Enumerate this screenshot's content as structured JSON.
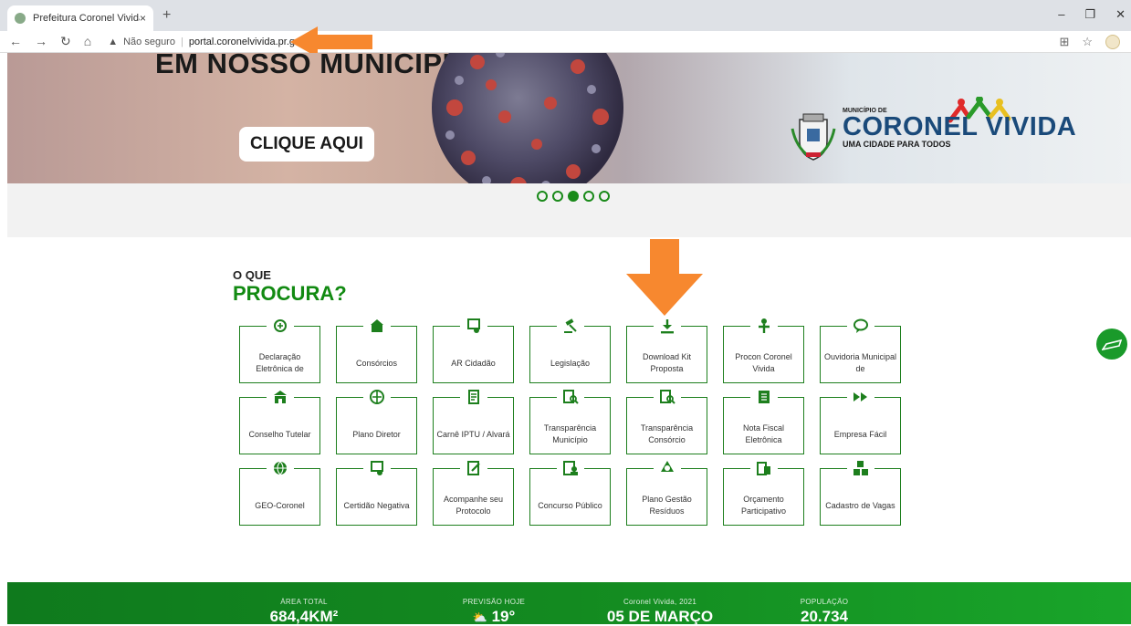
{
  "browser": {
    "tab_title": "Prefeitura Coronel Vivida",
    "tab_close": "×",
    "new_tab": "+",
    "security_label": "Não seguro",
    "url": "portal.coronelvivida.pr.gov.br/#"
  },
  "hero": {
    "headline": "EM NOSSO MUNICÍPIO",
    "cta": "CLIQUE AQUI",
    "brand_small": "MUNICÍPIO DE",
    "brand_name": "CORONEL VIVIDA",
    "brand_slogan": "UMA CIDADE PARA TODOS",
    "slides": 5,
    "active_slide": 3
  },
  "section": {
    "title_small": "O QUE",
    "title_big": "PROCURA?"
  },
  "services": [
    {
      "label": "Declaração Eletrônica de",
      "icon": "declaration-icon"
    },
    {
      "label": "Consórcios",
      "icon": "consortium-icon"
    },
    {
      "label": "AR Cidadão",
      "icon": "certificate-icon"
    },
    {
      "label": "Legislação",
      "icon": "gavel-icon"
    },
    {
      "label": "Download Kit Proposta",
      "icon": "download-icon"
    },
    {
      "label": "Procon Coronel Vivida",
      "icon": "procon-icon"
    },
    {
      "label": "Ouvidoria Municipal de",
      "icon": "chat-bubble-icon"
    },
    {
      "label": "Conselho Tutelar",
      "icon": "building-icon"
    },
    {
      "label": "Plano Diretor",
      "icon": "plan-icon"
    },
    {
      "label": "Carnê IPTU / Alvará",
      "icon": "document-icon"
    },
    {
      "label": "Transparência Município",
      "icon": "search-document-icon"
    },
    {
      "label": "Transparência Consórcio",
      "icon": "search-document-icon"
    },
    {
      "label": "Nota Fiscal Eletrônica",
      "icon": "invoice-icon"
    },
    {
      "label": "Empresa Fácil",
      "icon": "fast-forward-icon"
    },
    {
      "label": "GEO-Coronel",
      "icon": "globe-icon"
    },
    {
      "label": "Certidão Negativa",
      "icon": "certificate-icon"
    },
    {
      "label": "Acompanhe seu Protocolo",
      "icon": "edit-document-icon"
    },
    {
      "label": "Concurso Público",
      "icon": "candidate-icon"
    },
    {
      "label": "Plano Gestão Resíduos",
      "icon": "recycle-icon"
    },
    {
      "label": "Orçamento Participativo",
      "icon": "budget-icon"
    },
    {
      "label": "Cadastro de Vagas",
      "icon": "abc-blocks-icon"
    }
  ],
  "footer": {
    "area_label": "ÁREA TOTAL",
    "area_value": "684,4KM²",
    "weather_label": "PREVISÃO HOJE",
    "weather_value": "19°",
    "date_label": "Coronel Vivida, 2021",
    "date_value": "05 DE MARÇO",
    "pop_label": "POPULAÇÃO",
    "pop_value": "20.734"
  },
  "colors": {
    "brand_green": "#128a12",
    "accent_orange": "#f7882f",
    "footer_green": "#138a20"
  }
}
